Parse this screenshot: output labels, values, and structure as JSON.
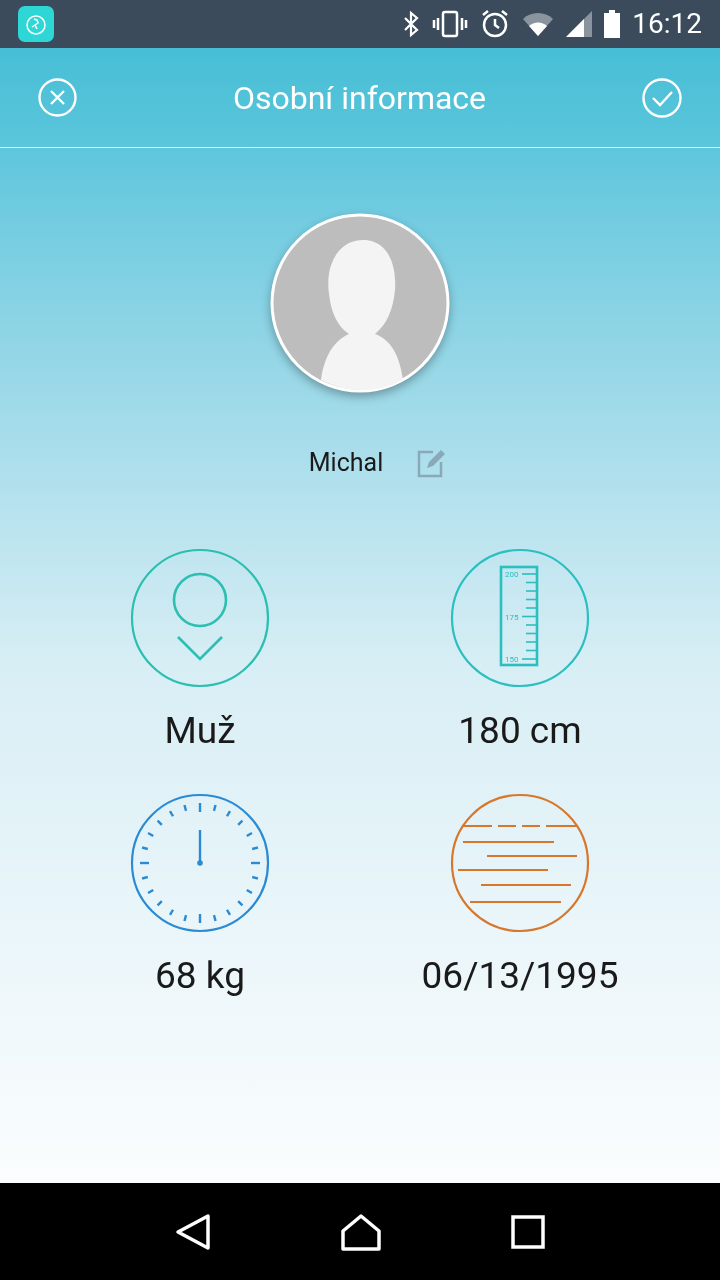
{
  "status_bar": {
    "time": "16:12"
  },
  "header": {
    "title": "Osobní informace"
  },
  "profile": {
    "name": "Michal"
  },
  "height_ruler": {
    "labels": [
      "200",
      "175",
      "150"
    ]
  },
  "stats": [
    {
      "kind": "gender",
      "value": "Muž",
      "color": "#2bbfb0"
    },
    {
      "kind": "height",
      "value": "180 cm",
      "color": "#2bbfc0"
    },
    {
      "kind": "weight",
      "value": "68 kg",
      "color": "#2a8bd4"
    },
    {
      "kind": "birthday",
      "value": "06/13/1995",
      "color": "#d7772c"
    }
  ]
}
